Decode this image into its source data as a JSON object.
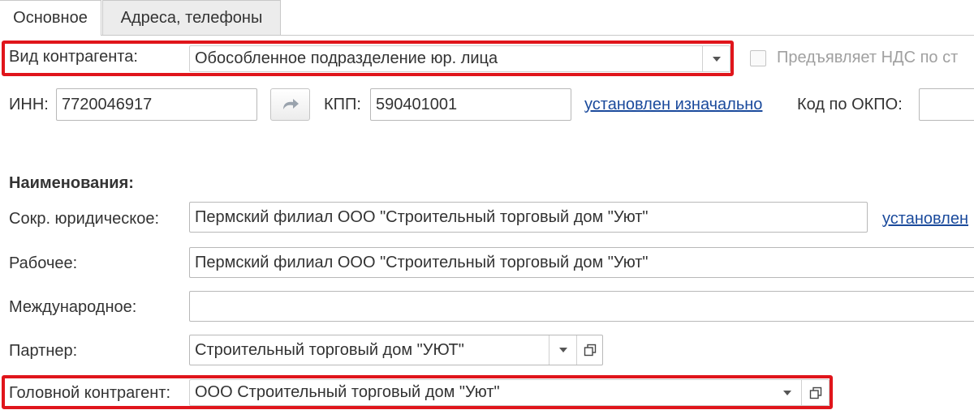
{
  "tabs": [
    {
      "label": "Основное",
      "active": true
    },
    {
      "label": "Адреса, телефоны",
      "active": false
    }
  ],
  "kind": {
    "label": "Вид контрагента:",
    "value": "Обособленное подразделение юр. лица"
  },
  "vat": {
    "label": "Предъявляет НДС по ст",
    "checked": false
  },
  "inn": {
    "label": "ИНН:",
    "value": "7720046917",
    "refresh_icon": "refresh-arrow-icon"
  },
  "kpp": {
    "label": "КПП:",
    "value": "590401001",
    "status_link": "установлен изначально"
  },
  "okpo": {
    "label": "Код по ОКПО:",
    "value": ""
  },
  "names": {
    "heading": "Наименования:",
    "short_legal": {
      "label": "Сокр. юридическое:",
      "value": "Пермский филиал ООО \"Строительный торговый дом \"Уют\"",
      "status_link": "установлен"
    },
    "working": {
      "label": "Рабочее:",
      "value": "Пермский филиал ООО \"Строительный торговый дом \"Уют\""
    },
    "international": {
      "label": "Международное:",
      "value": ""
    }
  },
  "partner": {
    "label": "Партнер:",
    "value": "Строительный торговый дом \"УЮТ\""
  },
  "head": {
    "label": "Головной контрагент:",
    "value": "ООО Строительный торговый дом \"Уют\""
  },
  "colors": {
    "highlight": "#e0151b",
    "link": "#1a4a9c",
    "text": "#333333",
    "border": "#b8b8b8"
  }
}
